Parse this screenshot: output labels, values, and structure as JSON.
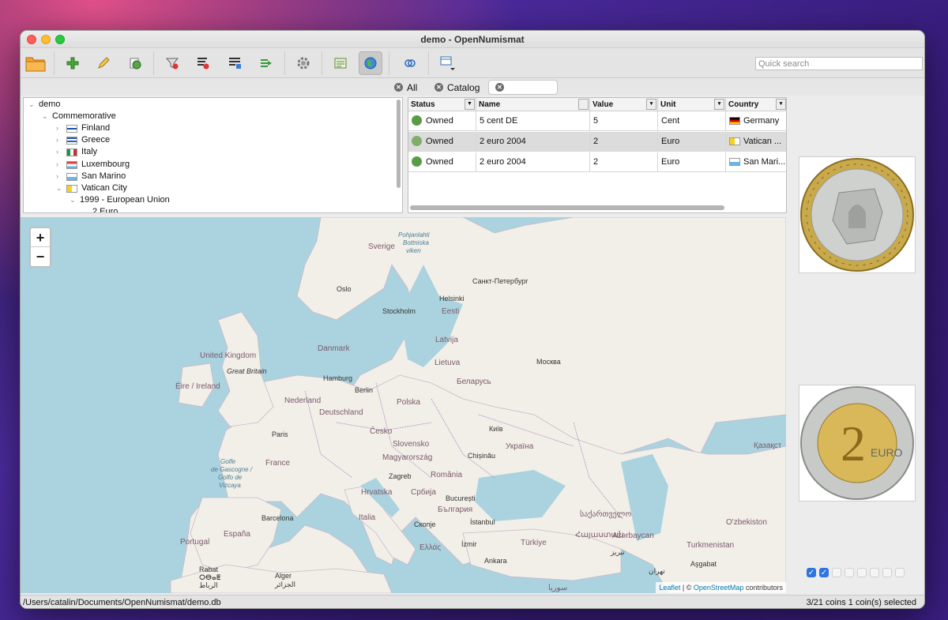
{
  "window": {
    "title": "demo - OpenNumismat"
  },
  "toolbar": {
    "buttons": [
      "open-folder",
      "add-coin",
      "edit-coin",
      "clone-coin",
      "filter",
      "sort",
      "report",
      "export",
      "settings",
      "statistics",
      "map",
      "link",
      "view-menu"
    ],
    "search_placeholder": "Quick search"
  },
  "tabs": [
    {
      "label": "All"
    },
    {
      "label": "Catalog"
    },
    {
      "label": ""
    }
  ],
  "tree": {
    "root": "demo",
    "commemorative": "Commemorative",
    "countries": [
      "Finland",
      "Greece",
      "Italy",
      "Luxembourg",
      "San Marino",
      "Vatican City"
    ],
    "period": "1999 - European Union",
    "value": "2 Euro"
  },
  "table": {
    "columns": [
      "Status",
      "Name",
      "Value",
      "Unit",
      "Country"
    ],
    "rows": [
      {
        "status": "Owned",
        "name": "5 cent DE",
        "value": "5",
        "unit": "Cent",
        "country": "Germany"
      },
      {
        "status": "Owned",
        "name": "2 euro 2004",
        "value": "2",
        "unit": "Euro",
        "country": "Vatican ..."
      },
      {
        "status": "Owned",
        "name": "2 euro 2004",
        "value": "2",
        "unit": "Euro",
        "country": "San Mari..."
      }
    ]
  },
  "map": {
    "zoom_in": "+",
    "zoom_out": "−",
    "attribution_leaflet": "Leaflet",
    "attribution_sep": "| ©",
    "attribution_osm": "OpenStreetMap",
    "attribution_tail": "contributors",
    "labels": {
      "sverige": "Sverige",
      "oslo": "Oslo",
      "stockholm": "Stockholm",
      "helsinki": "Helsinki",
      "spb": "Санкт-Петербург",
      "eesti": "Eesti",
      "latvija": "Latvija",
      "lietuva": "Lietuva",
      "moskva": "Москва",
      "belarus": "Беларусь",
      "danmark": "Danmark",
      "uk": "United Kingdom",
      "gb": "Great Britain",
      "eire": "Éire / Ireland",
      "hamburg": "Hamburg",
      "berlin": "Berlin",
      "nederland": "Nederland",
      "deutschland": "Deutschland",
      "polska": "Polska",
      "kyiv": "Київ",
      "ukraina": "Україна",
      "paris": "Paris",
      "france": "France",
      "cesko": "Česko",
      "slovensko": "Slovensko",
      "magyar": "Magyarország",
      "chisinau": "Chișinău",
      "zagreb": "Zagreb",
      "romania": "România",
      "hrvatska": "Hrvatska",
      "srbija": "Србија",
      "bucuresti": "București",
      "balgaria": "България",
      "barcelona": "Barcelona",
      "italia": "Italia",
      "skopje": "Скопје",
      "istanbul": "İstanbul",
      "sakartvelo": "საქართველო",
      "portugal": "Portugal",
      "espana": "España",
      "ellas": "Ελλάς",
      "izmir": "İzmir",
      "turkiye": "Türkiye",
      "hayastan": "Հայաստան",
      "azerbaycan": "Azərbaycan",
      "ankara": "Ankara",
      "algier": "Alger",
      "algier_ar": "الجزائر",
      "rabat": "Rabat",
      "rabat_ar": "ⵔⴱⴰⵟ",
      "rabat_ar2": "الرباط",
      "souria": "سوريا",
      "uzbek": "O'zbekiston",
      "turkmen": "Turkmenistan",
      "kazak": "Қазақст",
      "ashgabat": "Aşgabat",
      "tehran": "تهران",
      "tabriz": "تبریز",
      "pohjanlahti": "Pohjanlahti",
      "bottniska": "Bottniska",
      "viken": "viken",
      "golfe": "Golfe",
      "degasc": "de Gascogne /",
      "golfode": "Golfo de",
      "vizcaya": "Vizcaya"
    }
  },
  "status": {
    "path": "/Users/catalin/Documents/OpenNumismat/demo.db",
    "summary": "3/21 coins  1 coin(s) selected"
  },
  "image_checks": [
    true,
    true,
    false,
    false,
    false,
    false,
    false,
    false
  ]
}
